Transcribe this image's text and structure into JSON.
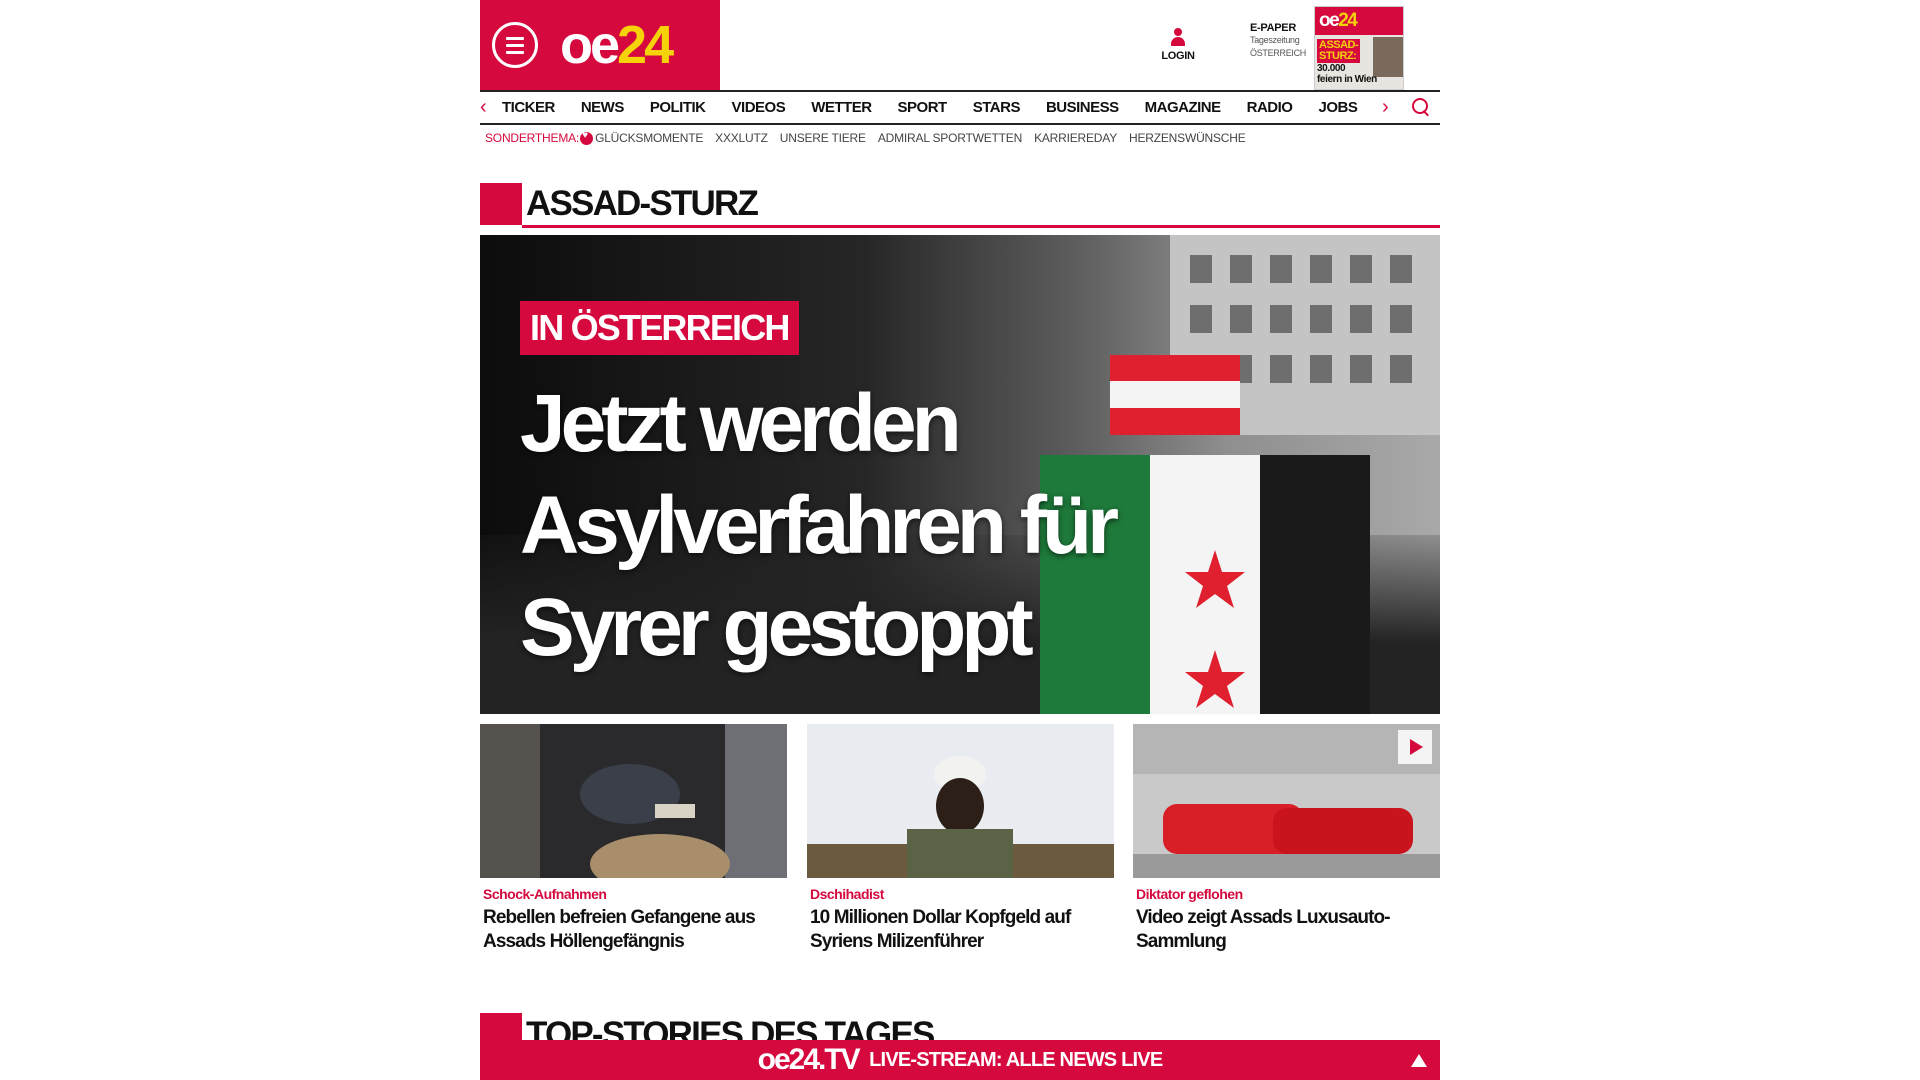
{
  "colors": {
    "brand": "#d5093d",
    "brand_yellow": "#f5d20a",
    "text": "#111111"
  },
  "header": {
    "logo_oe": "oe",
    "logo_24": "24",
    "menu_icon": "hamburger-menu-icon",
    "login_icon": "user-icon",
    "login_label": "LOGIN",
    "epaper_title": "E-PAPER",
    "epaper_sub1": "Tageszeitung",
    "epaper_sub2": "ÖSTERREICH",
    "epaper_thumb": {
      "logo_oe": "oe",
      "logo_24": "24",
      "headline_1": "ASSAD-",
      "headline_2": "STURZ:",
      "body_1": "30.000",
      "body_2": "feiern in Wien"
    }
  },
  "nav": {
    "items": [
      "TICKER",
      "NEWS",
      "POLITIK",
      "VIDEOS",
      "WETTER",
      "SPORT",
      "STARS",
      "BUSINESS",
      "MAGAZINE",
      "RADIO",
      "JOBS"
    ],
    "left_arrow": "‹",
    "right_arrow": "›",
    "search_icon": "search-icon"
  },
  "special": {
    "label": "SONDERTHEMA:",
    "icon": "heart-icon",
    "items": [
      "GLÜCKSMOMENTE",
      "XXXLUTZ",
      "UNSERE TIERE",
      "ADMIRAL SPORTWETTEN",
      "KARRIEREDAY",
      "HERZENSWÜNSCHE"
    ]
  },
  "section_title": "ASSAD-STURZ",
  "hero": {
    "tag": "IN ÖSTERREICH",
    "headline": "Jetzt werden Asylverfahren für Syrer gestoppt"
  },
  "cards": [
    {
      "kicker": "Schock-Aufnahmen",
      "title": "Rebellen befreien Gefangene aus Assads Höllengefängnis"
    },
    {
      "kicker": "Dschihadist",
      "title": "10 Millionen Dollar Kopfgeld auf Syriens Milizenführer"
    },
    {
      "kicker": "Diktator geflohen",
      "title": "Video zeigt Assads Luxusauto-Sammlung",
      "has_video": true
    }
  ],
  "top_stories_title": "TOP-STORIES DES TAGES",
  "live_bar": {
    "logo": "oe24.TV",
    "text": "LIVE-STREAM: ALLE NEWS LIVE",
    "up_icon": "arrow-up-icon"
  }
}
